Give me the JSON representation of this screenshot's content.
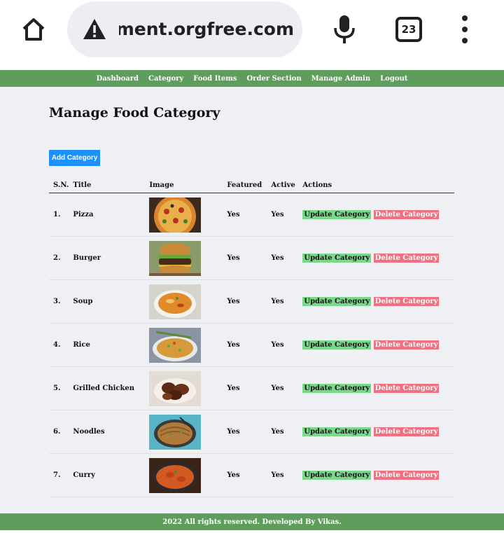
{
  "browser": {
    "url": "management.orgfree.com",
    "tab_count": "23",
    "icons": {
      "home": "home-icon",
      "warning": "warning-icon",
      "mic": "mic-icon",
      "menu": "more-vert-icon"
    }
  },
  "nav": {
    "items": [
      "Dashboard",
      "Category",
      "Food Items",
      "Order Section",
      "Manage Admin",
      "Logout"
    ],
    "bg_color": "#5e9d5c"
  },
  "page": {
    "title": "Manage Food Category",
    "add_button": "Add Category"
  },
  "table": {
    "headers": [
      "S.N.",
      "Title",
      "Image",
      "Featured",
      "Active",
      "Actions"
    ],
    "update_label": "Update Category",
    "delete_label": "Delete Category",
    "rows": [
      {
        "sn": "1.",
        "title": "Pizza",
        "image": "pizza",
        "featured": "Yes",
        "active": "Yes"
      },
      {
        "sn": "2.",
        "title": "Burger",
        "image": "burger",
        "featured": "Yes",
        "active": "Yes"
      },
      {
        "sn": "3.",
        "title": "Soup",
        "image": "soup",
        "featured": "Yes",
        "active": "Yes"
      },
      {
        "sn": "4.",
        "title": "Rice",
        "image": "rice",
        "featured": "Yes",
        "active": "Yes"
      },
      {
        "sn": "5.",
        "title": "Grilled Chicken",
        "image": "grilled-chicken",
        "featured": "Yes",
        "active": "Yes"
      },
      {
        "sn": "6.",
        "title": "Noodles",
        "image": "noodles",
        "featured": "Yes",
        "active": "Yes"
      },
      {
        "sn": "7.",
        "title": "Curry",
        "image": "curry",
        "featured": "Yes",
        "active": "Yes"
      }
    ]
  },
  "footer": {
    "text": "2022 All rights reserved. Developed By Vikas."
  },
  "colors": {
    "update": "#7ad88a",
    "delete": "#f07081",
    "add": "#1e90ff"
  }
}
